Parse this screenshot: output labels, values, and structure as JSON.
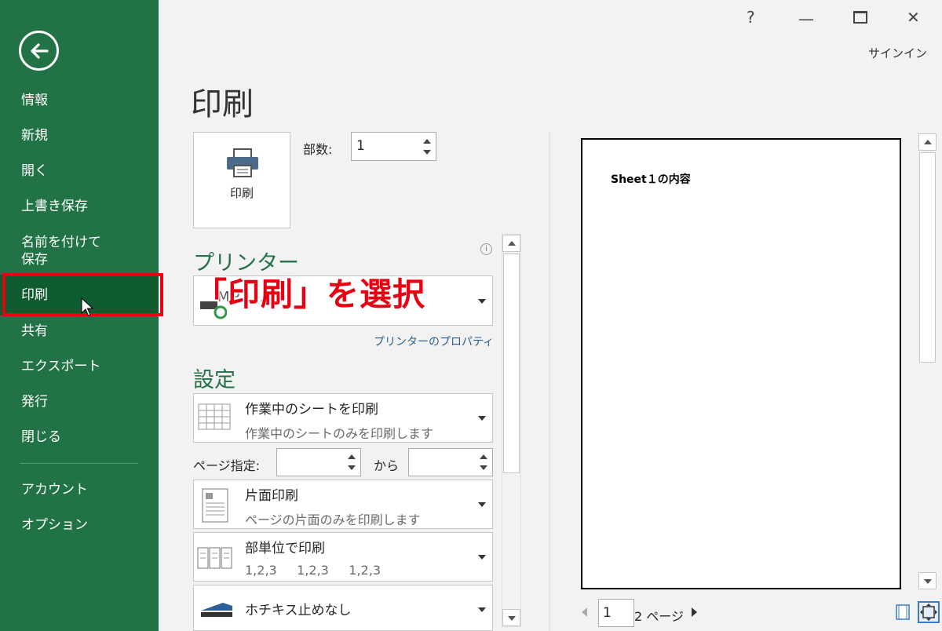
{
  "sidebar": {
    "items": [
      {
        "label": "情報"
      },
      {
        "label": "新規"
      },
      {
        "label": "開く"
      },
      {
        "label": "上書き保存"
      },
      {
        "label": "名前を付けて\n保存"
      },
      {
        "label": "印刷"
      },
      {
        "label": "共有"
      },
      {
        "label": "エクスポート"
      },
      {
        "label": "発行"
      },
      {
        "label": "閉じる"
      },
      {
        "label": "アカウント"
      },
      {
        "label": "オプション"
      }
    ],
    "active_index": 5
  },
  "window": {
    "help": "?",
    "minimize": "—",
    "close": "✕",
    "signin": "サインイン"
  },
  "page_title": "印刷",
  "print_button": {
    "label": "印刷"
  },
  "copies": {
    "label": "部数:",
    "value": "1"
  },
  "printer": {
    "heading": "プリンター",
    "name": "MP ... S",
    "properties_link": "プリンターのプロパティ"
  },
  "overlay_caption": "「印刷」を選択",
  "settings": {
    "heading": "設定",
    "print_what": {
      "title": "作業中のシートを印刷",
      "subtitle": "作業中のシートのみを印刷します"
    },
    "pages": {
      "label": "ページ指定:",
      "to_label": "から",
      "from_value": "",
      "to_value": ""
    },
    "sides": {
      "title": "片面印刷",
      "subtitle": "ページの片面のみを印刷します"
    },
    "collation": {
      "title": "部単位で印刷",
      "subtitle": "1,2,3     1,2,3     1,2,3"
    },
    "staple": {
      "title": "ホチキス止めなし"
    }
  },
  "preview": {
    "content": "Sheet１の内容"
  },
  "pager": {
    "current": "1",
    "total": "2 ページ"
  },
  "colors": {
    "sidebar": "#217346",
    "active": "#0e5c30",
    "highlight": "#e60012"
  }
}
